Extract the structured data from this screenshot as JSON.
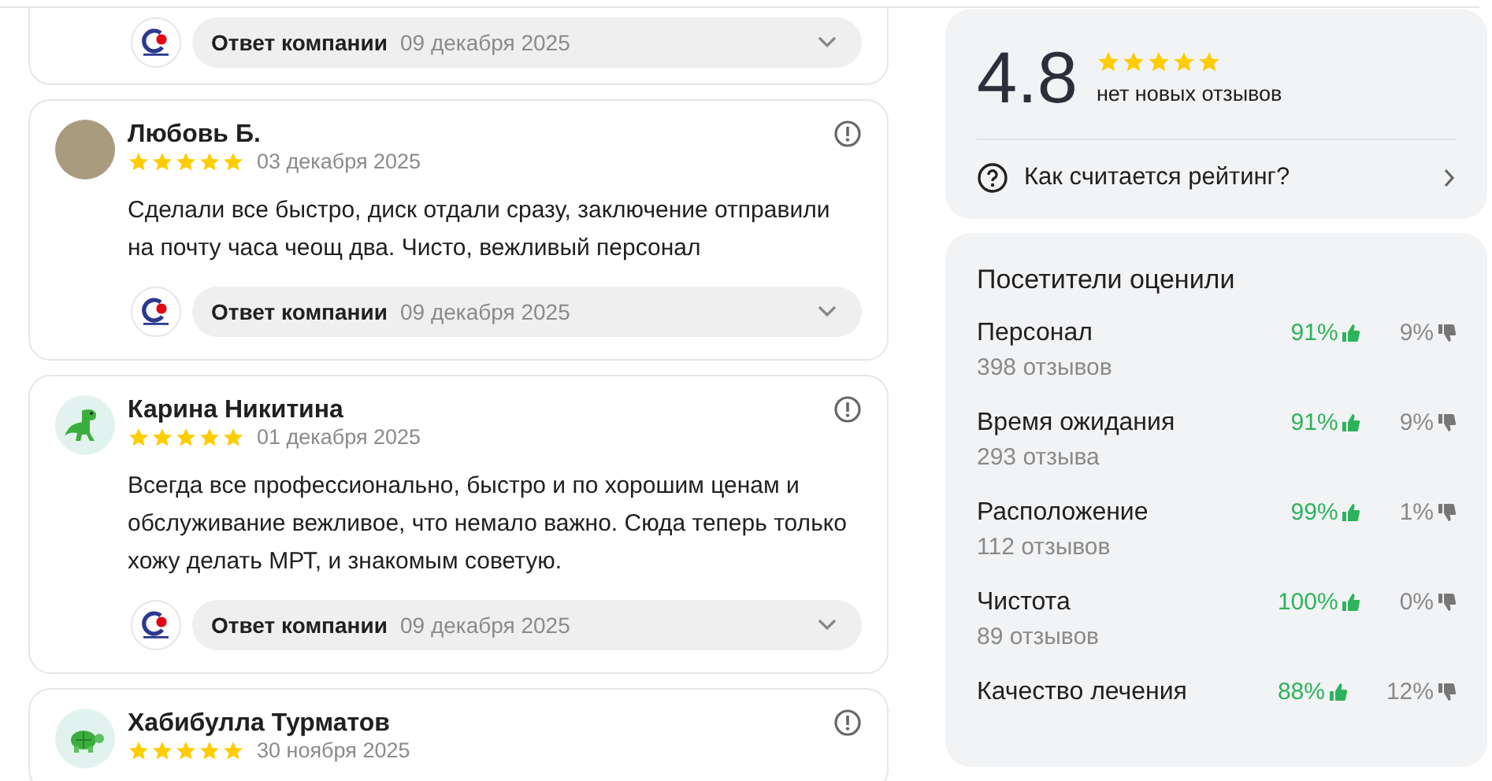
{
  "reviews": [
    {
      "partial": true,
      "reply": {
        "label": "Ответ компании",
        "date": "09 декабря 2025"
      }
    },
    {
      "partial": false,
      "author": "Любовь Б.",
      "avatar": {
        "kind": "photo"
      },
      "stars": 5,
      "date": "03 декабря 2025",
      "text": "Сделали все быстро, диск отдали сразу, заключение отправили на почту часа чеощ два. Чисто, вежливый персонал",
      "reply": {
        "label": "Ответ компании",
        "date": "09 декабря 2025"
      }
    },
    {
      "partial": false,
      "author": "Карина Никитина",
      "avatar": {
        "kind": "dinosaur"
      },
      "stars": 5,
      "date": "01 декабря 2025",
      "text": "Всегда все профессионально, быстро и по хорошим ценам и обслуживание вежливое, что немало важно. Сюда теперь только хожу делать МРТ, и знакомым советую.",
      "reply": {
        "label": "Ответ компании",
        "date": "09 декабря 2025"
      }
    },
    {
      "partial": false,
      "author": "Хабибулла Турматов",
      "avatar": {
        "kind": "turtle"
      },
      "stars": 5,
      "date": "30 ноября 2025"
    }
  ],
  "rating": {
    "value": "4.8",
    "stars": 5,
    "subtitle": "нет новых отзывов",
    "link": "Как считается рейтинг?"
  },
  "aspects": {
    "title": "Посетители оценили",
    "items": [
      {
        "name": "Персонал",
        "count": "398 отзывов",
        "positive": "91%",
        "negative": "9%"
      },
      {
        "name": "Время ожидания",
        "count": "293 отзыва",
        "positive": "91%",
        "negative": "9%"
      },
      {
        "name": "Расположение",
        "count": "112 отзывов",
        "positive": "99%",
        "negative": "1%"
      },
      {
        "name": "Чистота",
        "count": "89 отзывов",
        "positive": "100%",
        "negative": "0%"
      },
      {
        "name": "Качество лечения",
        "positive": "88%",
        "negative": "12%"
      }
    ]
  }
}
